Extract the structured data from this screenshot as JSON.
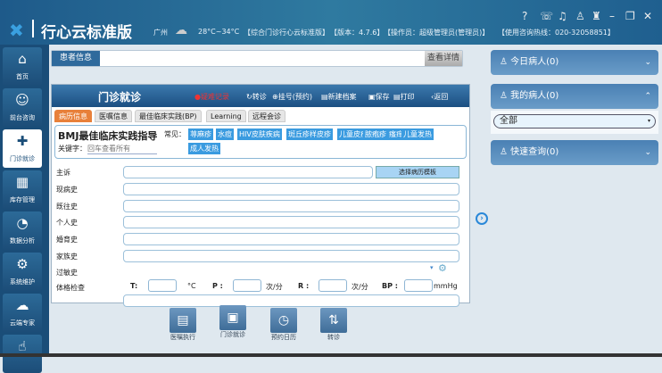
{
  "header": {
    "logo": "✖",
    "title": "行心云标准版",
    "city": "广州",
    "weather_icon": "thunderstorm-icon",
    "temp": "28°C~34°C",
    "system": "【综合门诊行心云标准版】",
    "version": "【版本：4.7.6】",
    "operator": "【操作员：超级管理员(管理员)】",
    "hotline": "【使用咨询热线：020-32058851】"
  },
  "sidebar": {
    "items": [
      {
        "label": "首页",
        "icon": "⌂"
      },
      {
        "label": "前台咨询",
        "icon": "☺"
      },
      {
        "label": "门诊就诊",
        "icon": "✚"
      },
      {
        "label": "库存管理",
        "icon": "▦"
      },
      {
        "label": "数据分析",
        "icon": "◔"
      },
      {
        "label": "系统维护",
        "icon": "⚙"
      },
      {
        "label": "云端专家",
        "icon": "☁"
      },
      {
        "label": "",
        "icon": "☝"
      }
    ]
  },
  "patient": {
    "label": "患者信息",
    "detail": "查看详情"
  },
  "panel": {
    "title": "门诊就诊",
    "toolbar": [
      "●疑难记录",
      "↻转诊",
      "⊕挂号(预约)",
      "▤新建档案",
      "▣保存",
      "▤打印",
      "‹返回"
    ],
    "tabs": [
      "病历信息",
      "医嘱信息",
      "最佳临床实践(BP)",
      "Learning",
      "远程会诊"
    ],
    "bmj": {
      "title": "BMJ最佳临床实践指导",
      "keyword_label": "关键字：",
      "keyword_placeholder": "回车查看所有",
      "common_label": "常见：",
      "chips": [
        "荨麻疹",
        "水痘",
        "HIV皮肤疾病",
        "斑丘疹样皮疹",
        "儿童皮疹",
        "脓疱疹",
        "瘙痒",
        "儿童发热",
        "成人发热"
      ]
    },
    "fields": [
      "主诉",
      "现病史",
      "既往史",
      "个人史",
      "婚育史",
      "家族史",
      "过敏史",
      "体格检查"
    ],
    "template_button": "选择病历模板",
    "vitals": {
      "t": "T:",
      "t_unit": "°C",
      "p": "P :",
      "p_unit": "次/分",
      "r": "R :",
      "r_unit": "次/分",
      "bp": "BP :",
      "bp_unit": "mmHg"
    }
  },
  "bottom": [
    {
      "label": "医嘱执行",
      "icon": "▤"
    },
    {
      "label": "门诊就诊",
      "icon": "▣"
    },
    {
      "label": "预约日历",
      "icon": "◷"
    },
    {
      "label": "转诊",
      "icon": "⇅"
    }
  ],
  "right": {
    "today": "今日病人(0)",
    "mine": "我的病人(0)",
    "select": "全部",
    "quick": "快速查询(0)"
  }
}
